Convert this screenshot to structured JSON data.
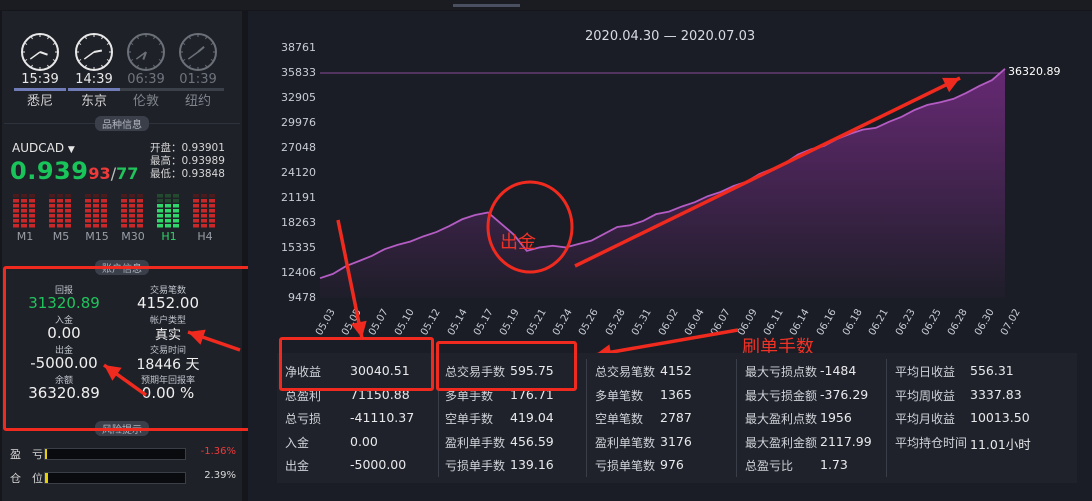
{
  "clocks": [
    {
      "time": "15:39",
      "city": "悉尼",
      "active": true
    },
    {
      "time": "14:39",
      "city": "东京",
      "active": true
    },
    {
      "time": "06:39",
      "city": "伦敦",
      "active": false
    },
    {
      "time": "01:39",
      "city": "纽约",
      "active": false
    }
  ],
  "sections": {
    "product": "品种信息",
    "account": "账户信息",
    "risk": "风险提示"
  },
  "quote": {
    "symbol": "AUDCAD",
    "price_main": "0.939",
    "price_a": "93",
    "price_sep": "/",
    "price_b": "77",
    "open": "开盘：0.93901",
    "high": "最高：0.93989",
    "low": "最低：0.93848"
  },
  "timeframes": [
    "M1",
    "M5",
    "M15",
    "M30",
    "H1",
    "H4"
  ],
  "account": {
    "profit_label": "回报",
    "profit_value": "31320.89",
    "trades_label": "交易笔数",
    "trades_value": "4152.00",
    "deposit_label": "入金",
    "deposit_value": "0.00",
    "acctype_label": "帐户类型",
    "acctype_value": "真实",
    "withdraw_label": "出金",
    "withdraw_value": "-5000.00",
    "time_label": "交易时间",
    "time_value": "18446 天",
    "balance_label": "余额",
    "balance_value": "36320.89",
    "annual_label": "预期年回报率",
    "annual_value": "0.00 %"
  },
  "risk": {
    "pnl_label": "盈　亏",
    "pnl_value": "-1.36%",
    "pos_label": "仓　位",
    "pos_value": "2.39%"
  },
  "colors": {
    "up": "#21c45c",
    "down": "#f03a3a",
    "area": "#6b2a78",
    "line": "#b45cc4",
    "annotation": "#f02a1e"
  },
  "chart_data": {
    "type": "area",
    "title": "2020.04.30 — 2020.07.03",
    "y_ticks": [
      9478,
      12406,
      15335,
      18263,
      21191,
      24120,
      27048,
      29976,
      32905,
      35833,
      38761
    ],
    "ylim": [
      9478,
      38761
    ],
    "x_ticks": [
      "05.03",
      "05.05",
      "05.07",
      "05.10",
      "05.12",
      "05.14",
      "05.17",
      "05.19",
      "05.21",
      "05.24",
      "05.26",
      "05.28",
      "05.31",
      "06.02",
      "06.04",
      "06.07",
      "06.09",
      "06.11",
      "06.14",
      "06.16",
      "06.18",
      "06.21",
      "06.23",
      "06.25",
      "06.28",
      "06.30",
      "07.02"
    ],
    "end_label": "36320.89",
    "reference_line": 35833,
    "series": [
      {
        "values": [
          11800,
          12300,
          13200,
          13800,
          14400,
          15200,
          15700,
          16100,
          16700,
          17200,
          17900,
          18700,
          19200,
          19500,
          18200,
          16900,
          15000,
          15400,
          15600,
          15400,
          15800,
          16200,
          17000,
          17800,
          18000,
          18500,
          19300,
          19600,
          20200,
          20700,
          21400,
          21900,
          22600,
          23100,
          24000,
          24600,
          25300,
          26300,
          26900,
          27300,
          28100,
          28700,
          29200,
          29400,
          30100,
          30700,
          31500,
          32100,
          32400,
          32800,
          33500,
          34300,
          35000,
          36320
        ]
      }
    ]
  },
  "annotations": {
    "withdraw": "出金",
    "scalp": "刷单手数"
  },
  "stats": {
    "col1": [
      {
        "label": "净收益",
        "value": "30040.51"
      },
      {
        "label": "总盈利",
        "value": "71150.88"
      },
      {
        "label": "总亏损",
        "value": "-41110.37"
      },
      {
        "label": "入金",
        "value": "0.00"
      },
      {
        "label": "出金",
        "value": "-5000.00"
      }
    ],
    "col2": [
      {
        "label": "总交易手数",
        "value": "595.75"
      },
      {
        "label": "多单手数",
        "value": "176.71"
      },
      {
        "label": "空单手数",
        "value": "419.04"
      },
      {
        "label": "盈利单手数",
        "value": "456.59"
      },
      {
        "label": "亏损单手数",
        "value": "139.16"
      }
    ],
    "col3": [
      {
        "label": "总交易笔数",
        "value": "4152"
      },
      {
        "label": "多单笔数",
        "value": "1365"
      },
      {
        "label": "空单笔数",
        "value": "2787"
      },
      {
        "label": "盈利单笔数",
        "value": "3176"
      },
      {
        "label": "亏损单笔数",
        "value": "976"
      }
    ],
    "col4": [
      {
        "label": "最大亏损点数",
        "value": "-1484"
      },
      {
        "label": "最大亏损金额",
        "value": "-376.29"
      },
      {
        "label": "最大盈利点数",
        "value": "1956"
      },
      {
        "label": "最大盈利金额",
        "value": "2117.99"
      },
      {
        "label": "总盈亏比",
        "value": "1.73"
      }
    ],
    "col5": [
      {
        "label": "平均日收益",
        "value": "556.31"
      },
      {
        "label": "平均周收益",
        "value": "3337.83"
      },
      {
        "label": "平均月收益",
        "value": "10013.50"
      },
      {
        "label": "平均持仓时间",
        "value": "11.01小时"
      }
    ]
  }
}
